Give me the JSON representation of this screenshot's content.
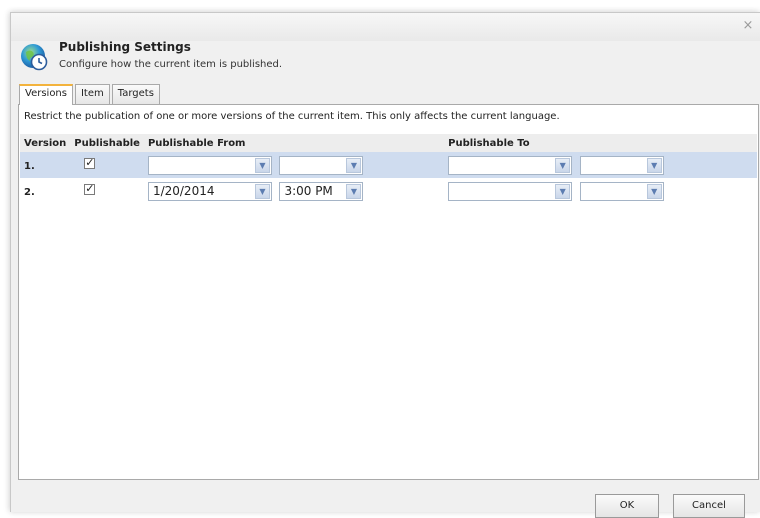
{
  "dialog": {
    "title": "Publishing Settings",
    "subtitle": "Configure how the current item is published.",
    "close_symbol": "×"
  },
  "tabs": [
    {
      "label": "Versions",
      "active": true
    },
    {
      "label": "Item",
      "active": false
    },
    {
      "label": "Targets",
      "active": false
    }
  ],
  "content": {
    "description": "Restrict the publication of one or more versions of the current item. This only affects the current language.",
    "columns": {
      "version": "Version",
      "publishable": "Publishable",
      "publishable_from": "Publishable From",
      "publishable_to": "Publishable To"
    },
    "rows": [
      {
        "version": "1.",
        "publishable": true,
        "from_date": "",
        "from_time": "",
        "to_date": "",
        "to_time": "",
        "selected": true
      },
      {
        "version": "2.",
        "publishable": true,
        "from_date": "1/20/2014",
        "from_time": "3:00 PM",
        "to_date": "",
        "to_time": "",
        "selected": false
      }
    ]
  },
  "buttons": {
    "ok": "OK",
    "cancel": "Cancel"
  },
  "icons": {
    "header": "globe-clock-icon",
    "dropdown": "chevron-down-icon",
    "close": "close-icon"
  },
  "colors": {
    "active_tab_accent": "#f3b33d",
    "selected_row": "#cfdcef",
    "header_row": "#ededed"
  }
}
